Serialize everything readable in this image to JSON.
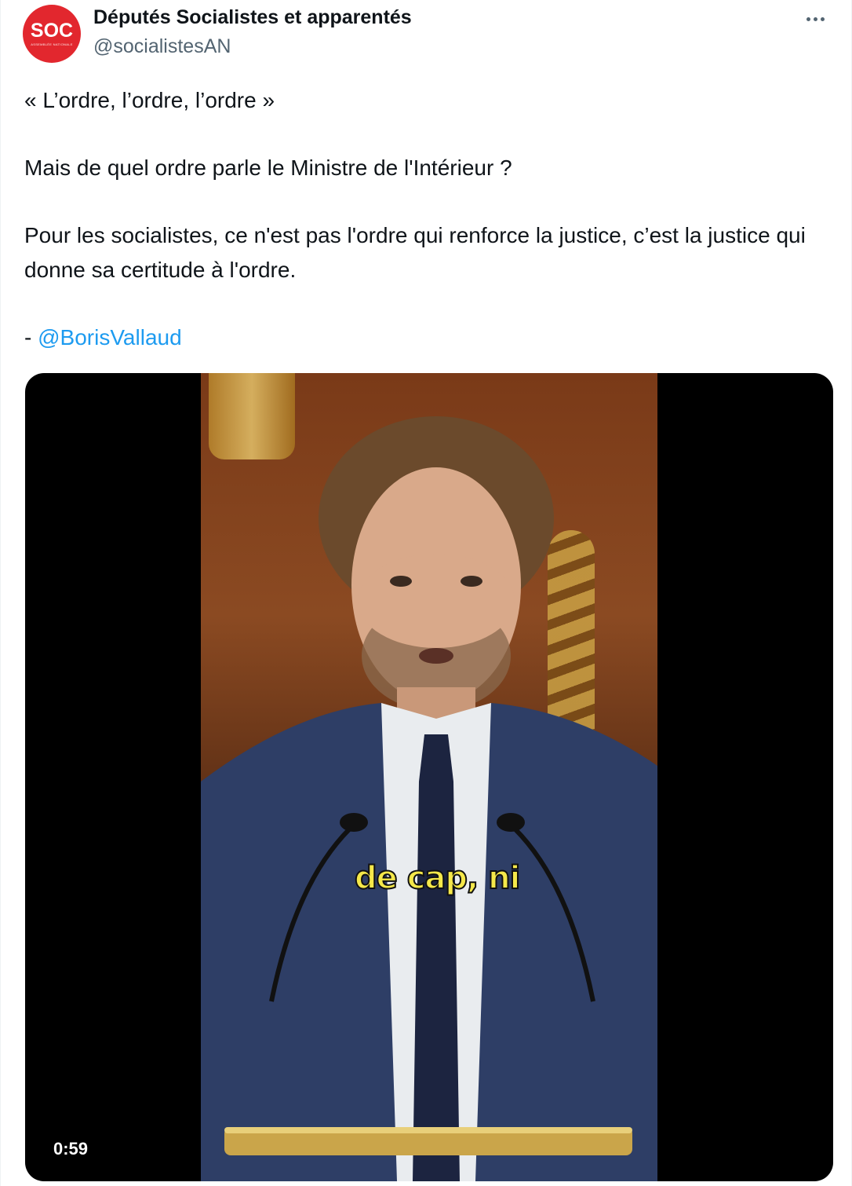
{
  "author": {
    "display_name": "Députés Socialistes et apparentés",
    "handle": "@socialistesAN",
    "avatar_text": "SOC",
    "avatar_subtext": "ASSEMBLÉE NATIONALE",
    "avatar_color": "#e2272e"
  },
  "more_icon": "more-horizontal-icon",
  "tweet": {
    "line1": "« L’ordre, l’ordre, l’ordre »",
    "line2": "Mais de quel ordre parle le Ministre de l'Intérieur ?",
    "line3": "Pour les socialistes, ce n'est pas l'ordre qui renforce la justice, c’est la justice qui donne sa certitude à l'ordre.",
    "signature_prefix": "- ",
    "mention": "@BorisVallaud"
  },
  "media": {
    "subtitle": "de cap, ni",
    "duration": "0:59"
  },
  "colors": {
    "link": "#1d9bf0",
    "secondary_text": "#536471",
    "subtitle_fill": "#f5e84a"
  }
}
